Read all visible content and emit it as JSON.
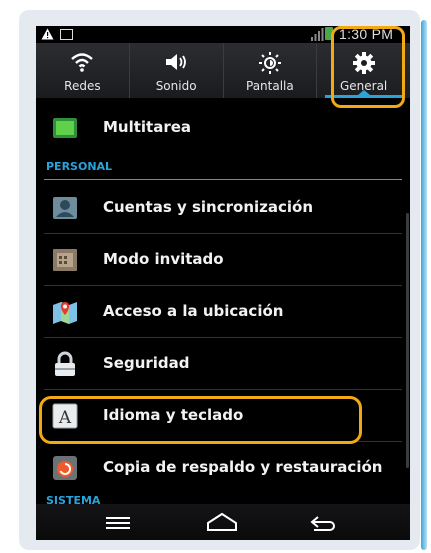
{
  "status_bar": {
    "time": "1:30 PM"
  },
  "tabs": [
    {
      "label": "Redes",
      "icon": "wifi-icon"
    },
    {
      "label": "Sonido",
      "icon": "speaker-icon"
    },
    {
      "label": "Pantalla",
      "icon": "brightness-icon"
    },
    {
      "label": "General",
      "icon": "gear-icon",
      "active": true
    }
  ],
  "list": {
    "multitarea": "Multitarea",
    "section_personal": "PERSONAL",
    "cuentas": "Cuentas y sincronización",
    "invitado": "Modo invitado",
    "ubicacion": "Acceso a la ubicación",
    "seguridad": "Seguridad",
    "idioma": "Idioma y teclado",
    "copia": "Copia de respaldo y restauración",
    "section_sistema": "SISTEMA"
  },
  "colors": {
    "accent": "#2aa3db",
    "highlight": "#f2aa14"
  }
}
